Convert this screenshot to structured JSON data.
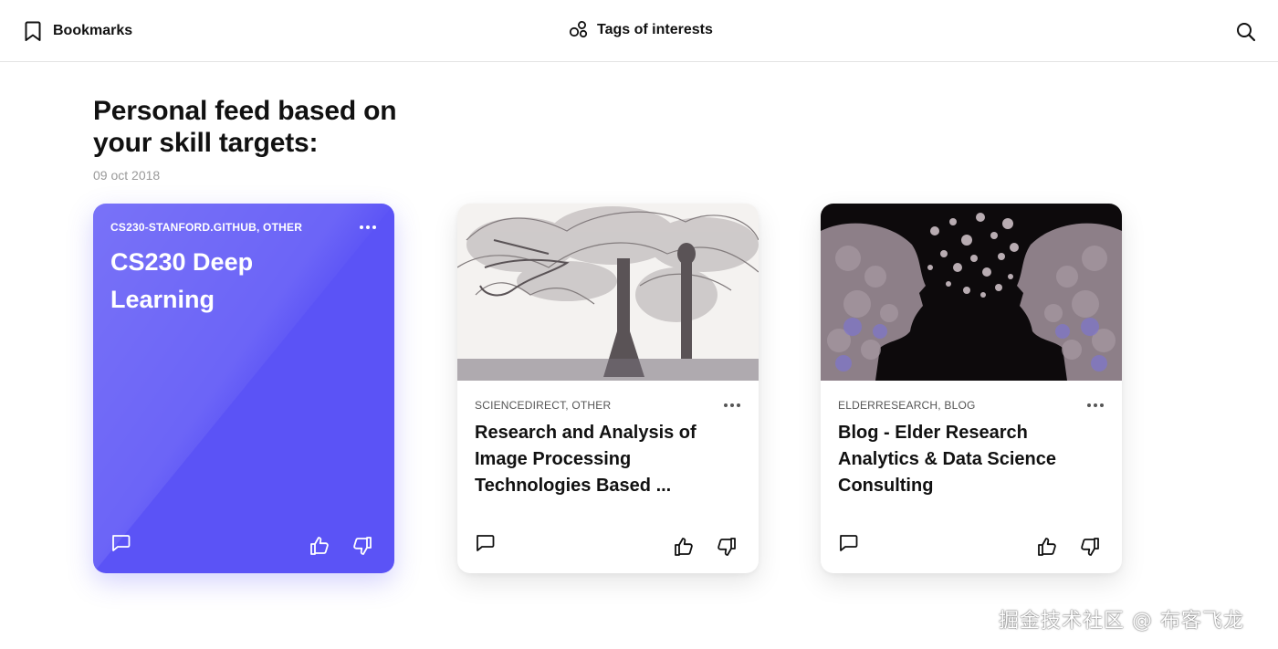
{
  "header": {
    "bookmarks_label": "Bookmarks",
    "bookmarks_icon": "bookmark-icon",
    "tags_label": "Tags of interests",
    "tags_icon": "tags-bubbles-icon",
    "search_icon": "search-icon"
  },
  "feed": {
    "heading": "Personal feed based on your skill targets:",
    "date": "09 oct 2018"
  },
  "cards": [
    {
      "source": "CS230-STANFORD.GITHUB, OTHER",
      "title": "CS230 Deep Learning",
      "style": "purple",
      "accent": "#5b53f6"
    },
    {
      "source": "SCIENCEDIRECT, OTHER",
      "title": "Research and Analysis of Image Processing Technologies Based ...",
      "image": "engraving-tree-illustration"
    },
    {
      "source": "ELDERRESEARCH, BLOG",
      "title": "Blog - Elder Research Analytics & Data Science Consulting",
      "image": "gear-heads-illustration"
    }
  ],
  "actions": {
    "comment_icon": "comment-icon",
    "like_icon": "thumbs-up-icon",
    "dislike_icon": "thumbs-down-icon",
    "more_icon": "more-dots-icon"
  },
  "watermark": "掘金技术社区 @ 布客飞龙"
}
